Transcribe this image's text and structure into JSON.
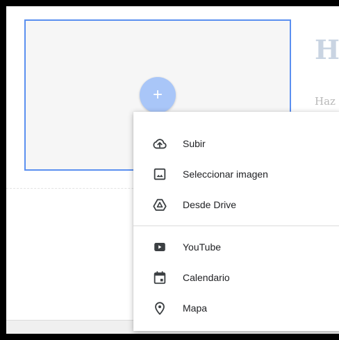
{
  "header": {
    "title_partial": "Ha",
    "subtitle_partial": "Haz"
  },
  "fab": {
    "symbol": "+"
  },
  "menu": {
    "group_upload": [
      {
        "label": "Subir",
        "icon": "cloud-upload-icon"
      },
      {
        "label": "Seleccionar imagen",
        "icon": "image-icon"
      },
      {
        "label": "Desde Drive",
        "icon": "drive-icon"
      }
    ],
    "group_embed": [
      {
        "label": "YouTube",
        "icon": "youtube-icon"
      },
      {
        "label": "Calendario",
        "icon": "calendar-icon"
      },
      {
        "label": "Mapa",
        "icon": "map-pin-icon"
      }
    ]
  },
  "colors": {
    "accent": "#5a8ff0",
    "fab": "#a9c6f8",
    "icon": "#3c4043"
  }
}
